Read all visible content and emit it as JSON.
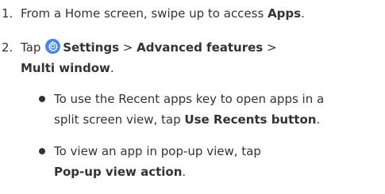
{
  "steps": [
    {
      "number": "1.",
      "text_prefix": "From a Home screen, swipe up to access ",
      "text_bold": "Apps",
      "text_suffix": "."
    },
    {
      "number": "2.",
      "tap_label": "Tap",
      "settings_label": "Settings",
      "sep1": " > ",
      "advanced_label": "Advanced features",
      "sep2": " >",
      "multi_window_label": "Multi window",
      "end_period": "."
    }
  ],
  "bullets": [
    {
      "line1": "To use the Recent apps key to open apps in a",
      "line2_prefix": "split screen view, tap ",
      "line2_bold": "Use Recents button",
      "line2_suffix": "."
    },
    {
      "line1": "To view an app in pop-up view, tap",
      "line2_bold": "Pop-up view action",
      "line2_suffix": "."
    }
  ],
  "icons": {
    "settings": "settings-gear-icon",
    "bullet": "bullet-dot-icon"
  },
  "colors": {
    "text": "#333333",
    "settings_icon": "#4a86d9"
  }
}
